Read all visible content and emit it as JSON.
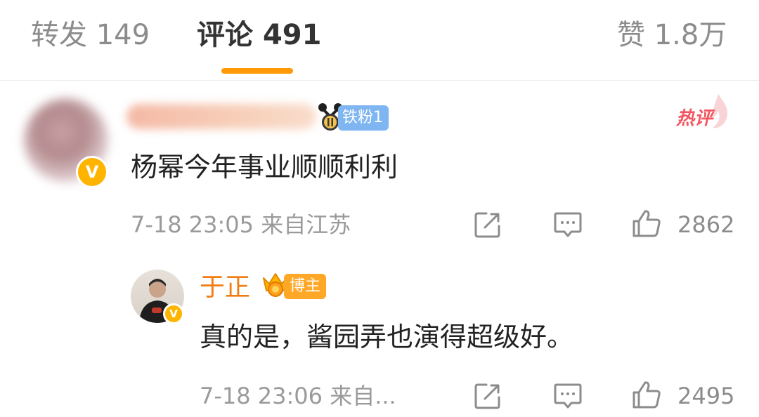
{
  "tabs": {
    "repost": {
      "label": "转发",
      "count": "149"
    },
    "comments": {
      "label": "评论",
      "count": "491"
    },
    "likes": {
      "label": "赞",
      "count": "1.8万"
    }
  },
  "comment": {
    "fan_badge": "铁粉1",
    "hot_label": "热评",
    "text": "杨幂今年事业顺顺利利",
    "time": "7-18 23:05",
    "location": "来自江苏",
    "like_count": "2862"
  },
  "reply": {
    "author": "于正",
    "role_badge": "博主",
    "text": "真的是，酱园弄也演得超级好。",
    "time": "7-18 23:06",
    "location": "来自...",
    "like_count": "2495"
  },
  "icons": {
    "share": "share-icon",
    "comment": "comment-icon",
    "like": "like-icon",
    "verified": "verified-v-icon"
  },
  "colors": {
    "accent": "#ff9a06",
    "blogger_name": "#f07c13",
    "hot": "#f35660",
    "fan_badge": "#7fb5f0",
    "verified": "#ffb400"
  }
}
